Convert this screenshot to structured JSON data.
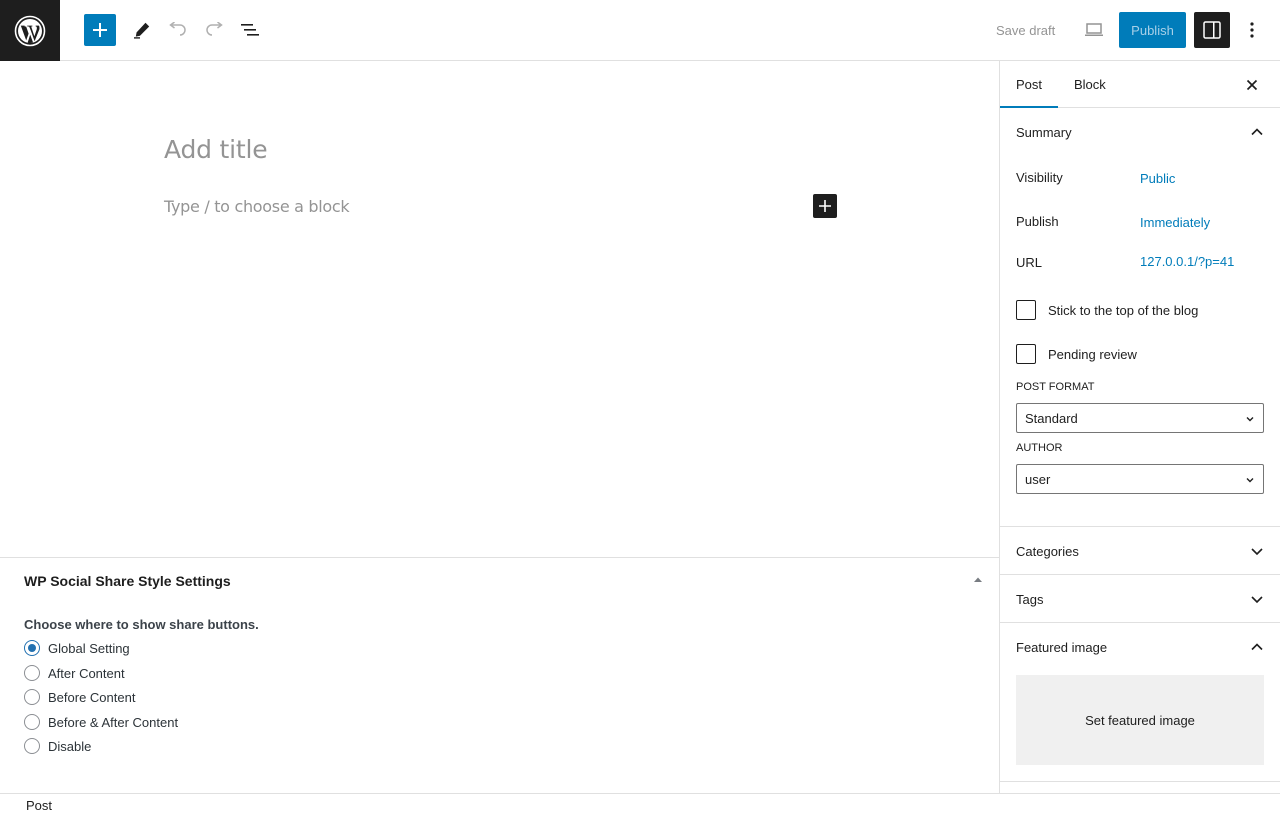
{
  "toolbar": {
    "logo_icon": "wordpress-logo",
    "inserter_icon": "plus-icon",
    "tools_icon": "pencil-icon",
    "undo_icon": "undo-icon",
    "redo_icon": "redo-icon",
    "list_view_icon": "list-view-icon",
    "save_draft_label": "Save draft",
    "preview_icon": "laptop-icon",
    "publish_label": "Publish",
    "settings_icon": "sidebar-toggle-icon",
    "options_icon": "vertical-ellipsis-icon",
    "accent_color": "#007cba"
  },
  "editor": {
    "title_placeholder": "Add title",
    "block_placeholder": "Type / to choose a block"
  },
  "metabox": {
    "title": "WP Social Share Style Settings",
    "question": "Choose where to show share buttons.",
    "options": [
      {
        "label": "Global Setting",
        "checked": true
      },
      {
        "label": "After Content",
        "checked": false
      },
      {
        "label": "Before Content",
        "checked": false
      },
      {
        "label": "Before & After Content",
        "checked": false
      },
      {
        "label": "Disable",
        "checked": false
      }
    ]
  },
  "footer": {
    "breadcrumb": "Post"
  },
  "sidebar": {
    "tabs": [
      {
        "label": "Post",
        "active": true
      },
      {
        "label": "Block",
        "active": false
      }
    ],
    "summary": {
      "title": "Summary",
      "rows": [
        {
          "label": "Visibility",
          "value": "Public"
        },
        {
          "label": "Publish",
          "value": "Immediately"
        },
        {
          "label": "URL",
          "value": "127.0.0.1/?p=41"
        }
      ],
      "checkboxes": [
        {
          "label": "Stick to the top of the blog",
          "checked": false
        },
        {
          "label": "Pending review",
          "checked": false
        }
      ],
      "post_format_label": "POST FORMAT",
      "post_format_value": "Standard",
      "author_label": "AUTHOR",
      "author_value": "user"
    },
    "panels": {
      "categories": "Categories",
      "tags": "Tags",
      "featured_image": "Featured image",
      "set_featured_image": "Set featured image"
    }
  }
}
